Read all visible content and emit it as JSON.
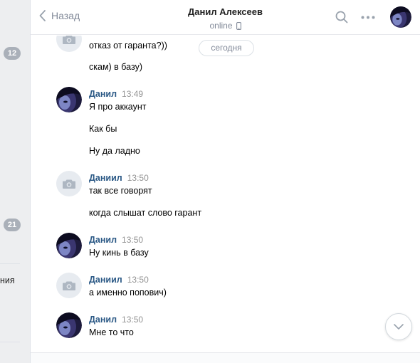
{
  "sidebar": {
    "badges": [
      "12",
      "21"
    ],
    "partial_text": "ния"
  },
  "header": {
    "back_label": "Назад",
    "peer_name": "Данил Алексеев",
    "peer_status": "online"
  },
  "history": {
    "date_chip": "сегодня",
    "top_partial_lines": [
      "отказ от гаранта?))",
      "скам) в базу)"
    ],
    "groups": [
      {
        "author": "Данил",
        "time": "13:49",
        "lines": [
          "Я про аккаунт",
          "Как бы",
          "Ну да ладно"
        ]
      },
      {
        "author": "Даниил",
        "time": "13:50",
        "lines": [
          "так все говорят",
          "когда слышат слово гарант"
        ]
      },
      {
        "author": "Данил",
        "time": "13:50",
        "lines": [
          "Ну кинь в базу"
        ]
      },
      {
        "author": "Даниил",
        "time": "13:50",
        "lines": [
          "а именно попович)"
        ]
      },
      {
        "author": "Данил",
        "time": "13:50",
        "lines": [
          "Мне то что"
        ]
      }
    ]
  },
  "colors": {
    "link": "#2a5885",
    "muted": "#828a99",
    "badge": "#aab0b9",
    "sidebar_bg": "#edeef0"
  },
  "icons": [
    "chevron-left-icon",
    "phone-icon",
    "search-icon",
    "more-icon",
    "camera-icon",
    "chevron-down-icon"
  ]
}
